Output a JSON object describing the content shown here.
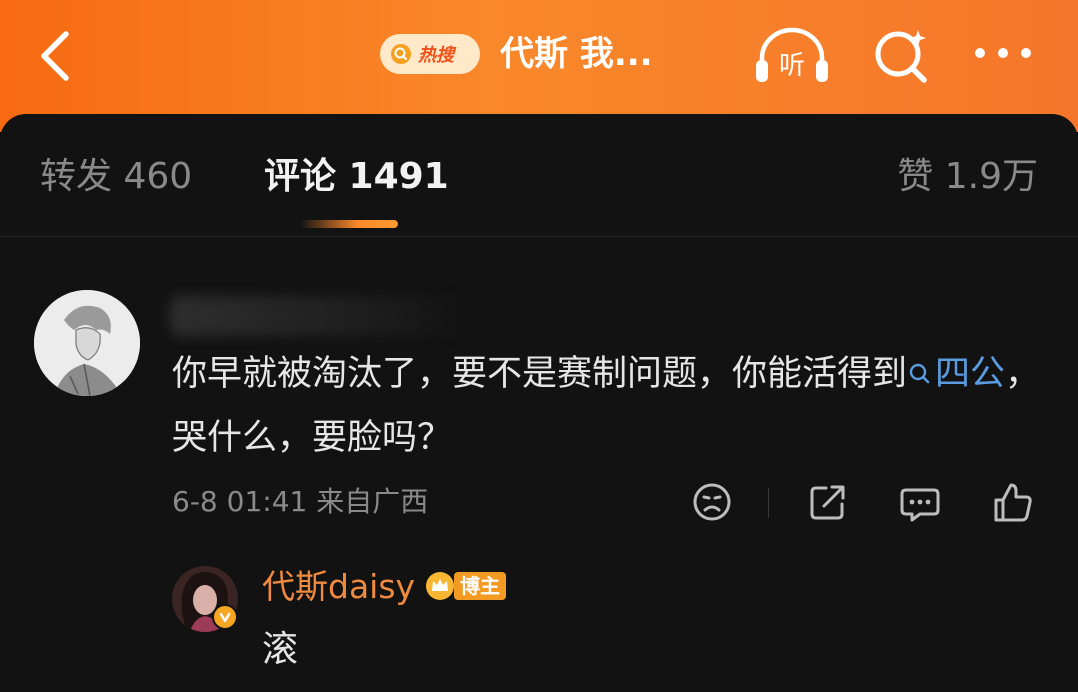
{
  "header": {
    "hot_label": "热搜",
    "topic_title": "代斯 我...",
    "listen_label": "听",
    "accent_color": "#f86a12"
  },
  "tabs": {
    "repost": "转发 460",
    "comment": "评论 1491",
    "like": "赞 1.9万"
  },
  "comment": {
    "text_before": "你早就被淘汰了，要不是赛制问题，你能活得到",
    "topic": "四公",
    "text_after": "，哭什么，要脸吗？",
    "time": "6-8 01:41",
    "location": "来自广西",
    "actions": [
      "dislike-face-icon",
      "share-icon",
      "reply-icon",
      "like-icon"
    ]
  },
  "reply": {
    "author": "代斯daisy",
    "badge": "博主",
    "text": "滚",
    "name_color": "#f08a3e"
  }
}
